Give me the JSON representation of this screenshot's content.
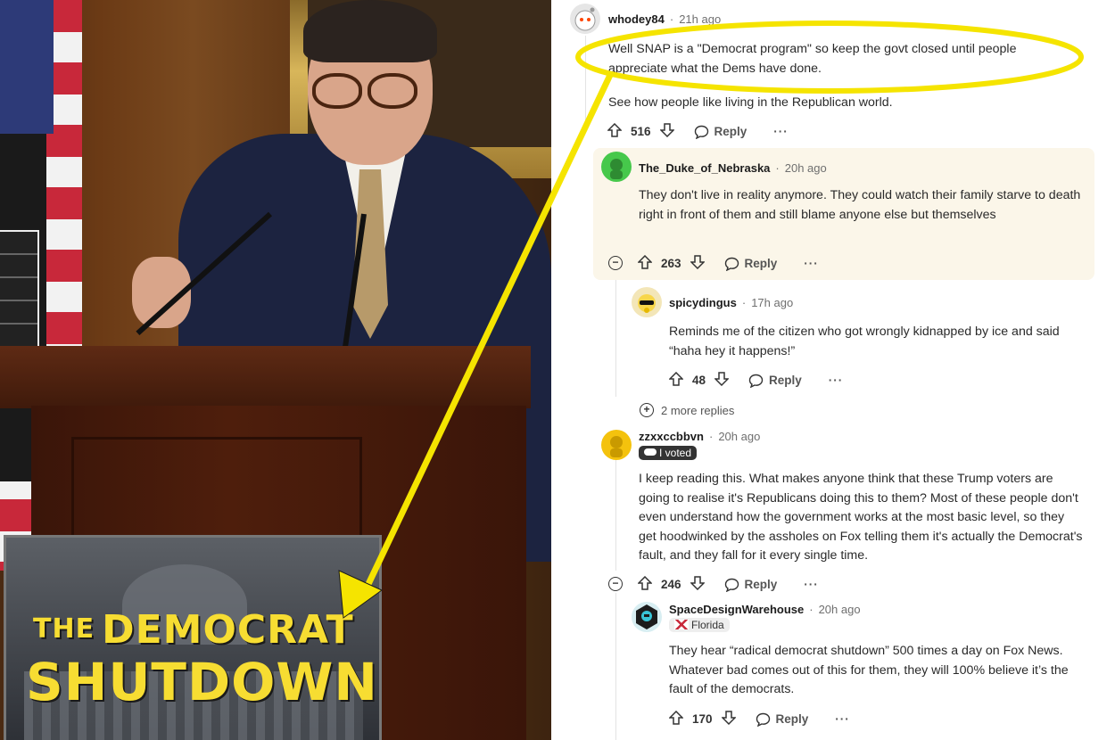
{
  "photo": {
    "sign_the": "THE",
    "sign_line1": "DEMOCRAT",
    "sign_line2": "SHUTDOWN"
  },
  "comments": [
    {
      "user": "whodey84",
      "time": "21h ago",
      "text_1": "Well SNAP is a \"Democrat program\" so keep the govt closed until people appreciate what the Dems have done.",
      "text_2": "See how people like living in the Republican world.",
      "votes": "516",
      "reply": "Reply",
      "more": "···"
    },
    {
      "user": "The_Duke_of_Nebraska",
      "time": "20h ago",
      "text": "They don't live in reality anymore. They could watch their family starve to death right in front of them and still blame anyone else but themselves",
      "votes": "263",
      "reply": "Reply",
      "more": "···"
    },
    {
      "user": "spicydingus",
      "time": "17h ago",
      "text": "Reminds me of the citizen who got wrongly kidnapped by ice and said “haha hey it happens!”",
      "votes": "48",
      "reply": "Reply",
      "more": "···"
    },
    {
      "user": "zzxxccbbvn",
      "time": "20h ago",
      "flair": "I voted",
      "text": "I keep reading this. What makes anyone think that these Trump voters are going to realise it's Republicans doing this to them? Most of these people don't even understand how the government works at the most basic level, so they get hoodwinked by the assholes on Fox telling them it's actually the Democrat's fault, and they fall for it every single time.",
      "votes": "246",
      "reply": "Reply",
      "more": "···"
    },
    {
      "user": "SpaceDesignWarehouse",
      "time": "20h ago",
      "flair": "Florida",
      "text": "They hear “radical democrat shutdown” 500 times a day on Fox News. Whatever bad comes out of this for them, they will 100% believe it’s the fault of the democrats.",
      "votes": "170",
      "reply": "Reply",
      "more": "···"
    }
  ],
  "more_replies": "2 more replies",
  "separator": "·",
  "icons": {
    "upvote": "upvote-icon",
    "downvote": "downvote-icon",
    "reply": "reply-bubble-icon",
    "collapse": "collapse-icon",
    "expand": "expand-icon"
  },
  "colors": {
    "annotation": "#f5e400",
    "highlight_bg": "#fbf6e9",
    "sign_text": "#f7dd32"
  }
}
